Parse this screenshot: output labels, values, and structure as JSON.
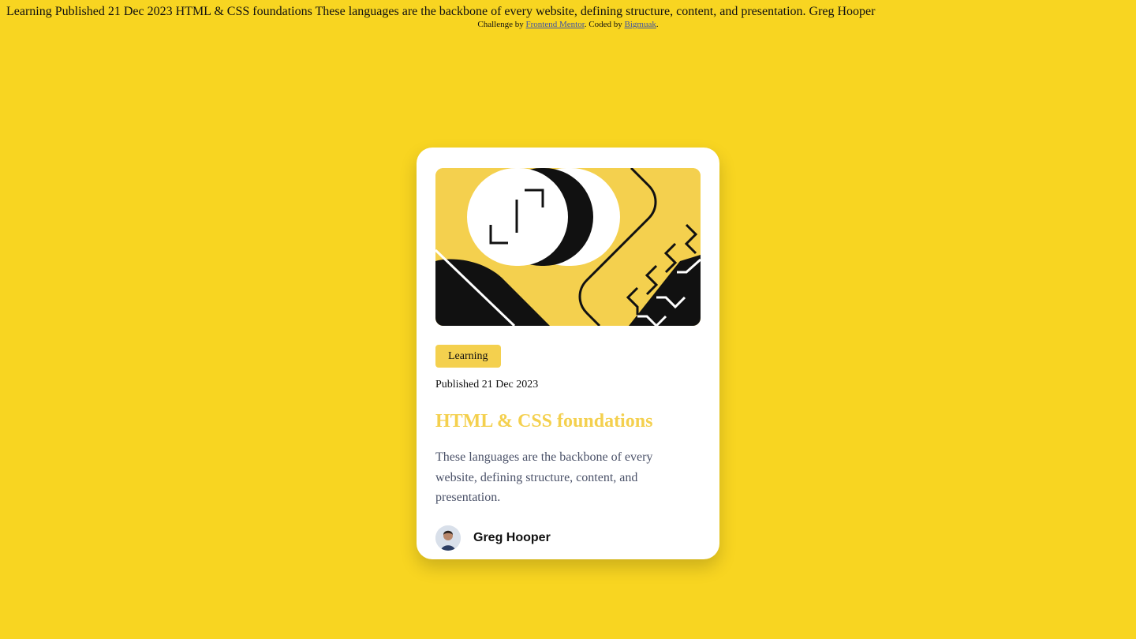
{
  "page": {
    "top_text": "Learning Published 21 Dec 2023 HTML & CSS foundations These languages are the backbone of every website, defining structure, content, and presentation. Greg Hooper",
    "background_color": "#F8D521"
  },
  "attribution": {
    "prefix": "Challenge by ",
    "link1": "Frontend Mentor",
    "middle": ". Coded by ",
    "link2": "Bigmuak",
    "suffix": "."
  },
  "card": {
    "illustration_icon": "html-css-illustration",
    "tag": "Learning",
    "published": "Published 21 Dec 2023",
    "title": "HTML & CSS foundations",
    "description": "These languages are the backbone of every website, defining structure, content, and presentation.",
    "author_name": "Greg Hooper",
    "accent_color": "#F4D04E"
  }
}
